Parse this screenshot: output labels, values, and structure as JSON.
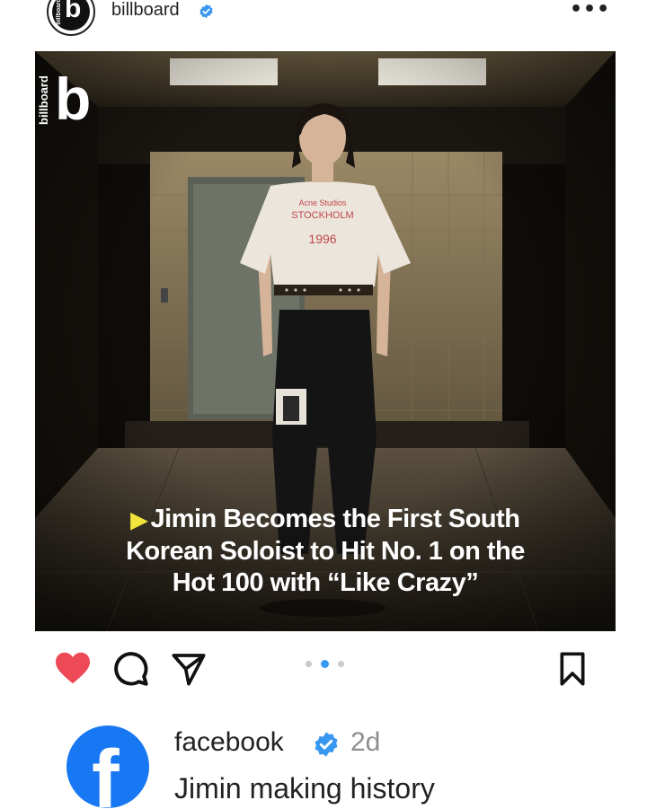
{
  "post": {
    "account_name": "billboard",
    "avatar_text": "billboard",
    "avatar_letter": "b",
    "more_icon": "more-horizontal-icon",
    "verified_icon": "verified-badge-icon"
  },
  "media": {
    "brand_watermark": "billboard",
    "brand_letter": "b",
    "headline_play_icon": "play-triangle-icon",
    "headline": "Jimin Becomes the First South Korean Soloist to Hit No. 1 on the Hot 100 with “Like Crazy”",
    "headline_lines": [
      "Jimin Becomes the First South",
      "Korean Soloist to Hit No. 1 on the",
      "Hot 100 with “Like Crazy”"
    ],
    "shirt_text": [
      "Acne Studios",
      "STOCKHOLM",
      "1996"
    ]
  },
  "actions": {
    "like_icon": "heart-filled-icon",
    "comment_icon": "comment-bubble-icon",
    "share_icon": "paper-plane-icon",
    "save_icon": "bookmark-icon",
    "carousel_total": 3,
    "carousel_active_index": 1
  },
  "comment": {
    "username": "facebook",
    "time": "2d",
    "text": "Jimin making history"
  },
  "colors": {
    "accent_heart": "#ed4956",
    "verified_blue": "#3897f0",
    "facebook_blue": "#1877f2",
    "play_yellow": "#f2e43b",
    "carousel_active": "#3897f0"
  }
}
